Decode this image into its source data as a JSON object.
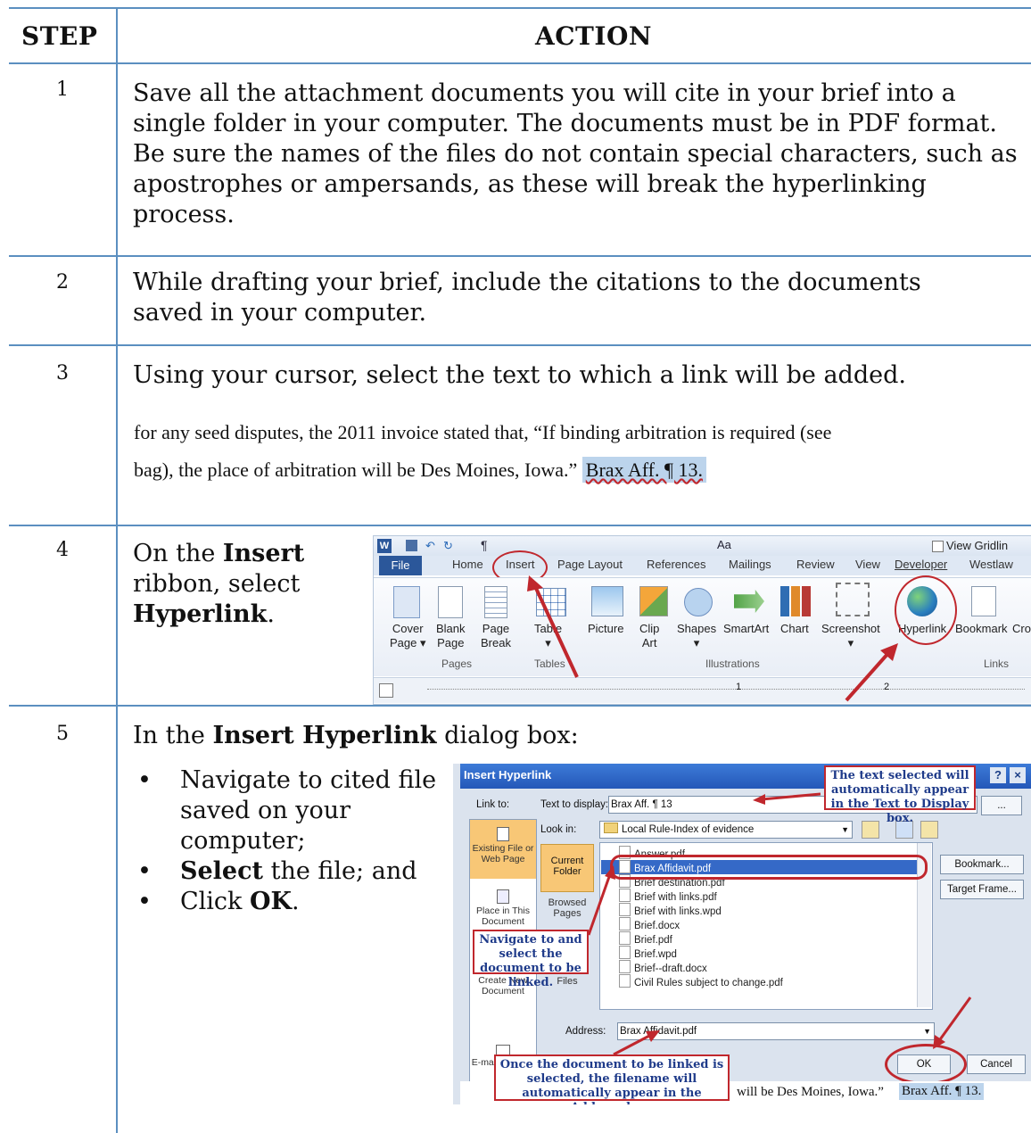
{
  "header": {
    "step": "STEP",
    "action": "ACTION"
  },
  "rows": [
    {
      "step": "1",
      "text": "Save all the attachment documents you will cite in your brief into a single folder in your computer. The documents must be in PDF format. Be sure the names of the files do not contain special characters, such as apostrophes or ampersands, as these will break the hyperlinking process."
    },
    {
      "step": "2",
      "text": "While drafting your brief, include the citations to the documents saved in your computer."
    },
    {
      "step": "3",
      "text": "Using your cursor, select the text to which a link will be added."
    },
    {
      "step": "4",
      "text_pre": "On the ",
      "bold1": "Insert",
      "text_mid": " ribbon, select ",
      "bold2": "Hyperlink",
      "text_post": "."
    },
    {
      "step": "5",
      "text_pre": "In the ",
      "bold1": "Insert Hyperlink",
      "text_post": " dialog box:"
    }
  ],
  "step3_example": {
    "line1": "for any seed disputes, the 2011 invoice stated that, “If binding arbitration is required (see",
    "line2": "bag), the place of arbitration will be Des Moines, Iowa.”",
    "citation": "Brax Aff. ¶ 13."
  },
  "step5_bullets": [
    {
      "text": "Navigate to cited file saved on your computer;"
    },
    {
      "bold": "Select",
      "text": " the file; and"
    },
    {
      "text": "Click ",
      "bold_after": "OK",
      "post": "."
    }
  ],
  "ribbon": {
    "quick_access_right": "View Gridlin",
    "tabs": [
      "File",
      "Home",
      "Insert",
      "Page Layout",
      "References",
      "Mailings",
      "Review",
      "View",
      "Developer",
      "Westlaw"
    ],
    "buttons": [
      {
        "label": "Cover\nPage ▾",
        "icon": "cover-page-icon"
      },
      {
        "label": "Blank\nPage",
        "icon": "blank-page-icon"
      },
      {
        "label": "Page\nBreak",
        "icon": "page-break-icon"
      },
      {
        "label": "Table\n▾",
        "icon": "table-icon"
      },
      {
        "label": "Picture",
        "icon": "picture-icon"
      },
      {
        "label": "Clip\nArt",
        "icon": "clip-art-icon"
      },
      {
        "label": "Shapes\n▾",
        "icon": "shapes-icon"
      },
      {
        "label": "SmartArt",
        "icon": "smartart-icon"
      },
      {
        "label": "Chart",
        "icon": "chart-icon"
      },
      {
        "label": "Screenshot\n▾",
        "icon": "screenshot-icon"
      },
      {
        "label": "Hyperlink",
        "icon": "hyperlink-icon"
      },
      {
        "label": "Bookmark",
        "icon": "bookmark-icon"
      },
      {
        "label": "Cro",
        "icon": "cross-reference-icon"
      }
    ],
    "groups": [
      "Pages",
      "Tables",
      "Illustrations",
      "Links"
    ],
    "ruler_marks": [
      "1",
      "2"
    ]
  },
  "dialog": {
    "title": "Insert Hyperlink",
    "link_to_label": "Link to:",
    "text_to_display_label": "Text to display:",
    "text_to_display_value": "Brax Aff. ¶ 13",
    "look_in_label": "Look in:",
    "look_in_value": "Local Rule-Index of evidence",
    "link_to_options": [
      "Existing File or Web Page",
      "Place in This Document",
      "Create New Document",
      "E-mail Address"
    ],
    "sub_nav": [
      "Current Folder",
      "Browsed Pages",
      "Recent Files"
    ],
    "files": [
      "Answer.pdf",
      "Brax Affidavit.pdf",
      "Brief destination.pdf",
      "Brief with links.pdf",
      "Brief with links.wpd",
      "Brief.docx",
      "Brief.pdf",
      "Brief.wpd",
      "Brief--draft.docx",
      "Civil Rules subject to change.pdf"
    ],
    "right_buttons": [
      "Bookmark...",
      "Target Frame..."
    ],
    "address_label": "Address:",
    "address_value": "Brax Affidavit.pdf",
    "ok": "OK",
    "cancel": "Cancel",
    "bottom_text": "will be Des Moines, Iowa.”",
    "bottom_citation": "Brax Aff. ¶ 13.",
    "callout_top": "The text selected will automatically appear in the Text to Display box.",
    "callout_left": "Navigate to and select the document to be linked.",
    "callout_bottom": "Once the document to be linked is selected, the filename will automatically appear in the Address box."
  }
}
